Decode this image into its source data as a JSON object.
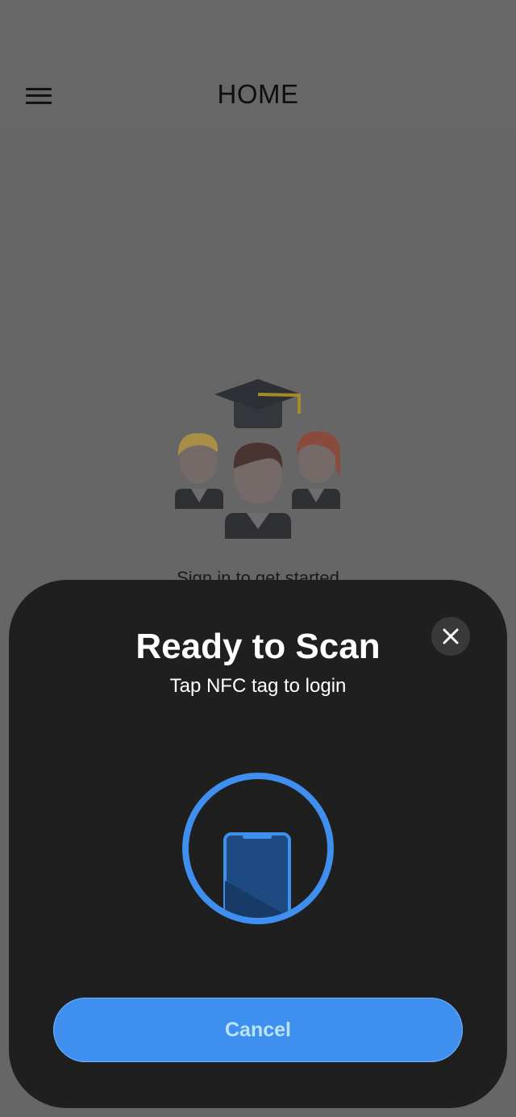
{
  "header": {
    "title": "HOME",
    "menu_icon": "hamburger-menu-icon"
  },
  "main": {
    "illustration": "graduates-illustration",
    "signin_hint": "Sign in to get started"
  },
  "nfc_sheet": {
    "title": "Ready to Scan",
    "subtitle": "Tap NFC tag to login",
    "cancel_label": "Cancel",
    "close_icon": "close-icon",
    "scan_icon": "phone-scan-icon"
  },
  "colors": {
    "overlay_background": "#666666",
    "sheet_background": "#1f1f20",
    "accent_blue": "#3f8fef",
    "cancel_text": "#b8e4ff"
  }
}
